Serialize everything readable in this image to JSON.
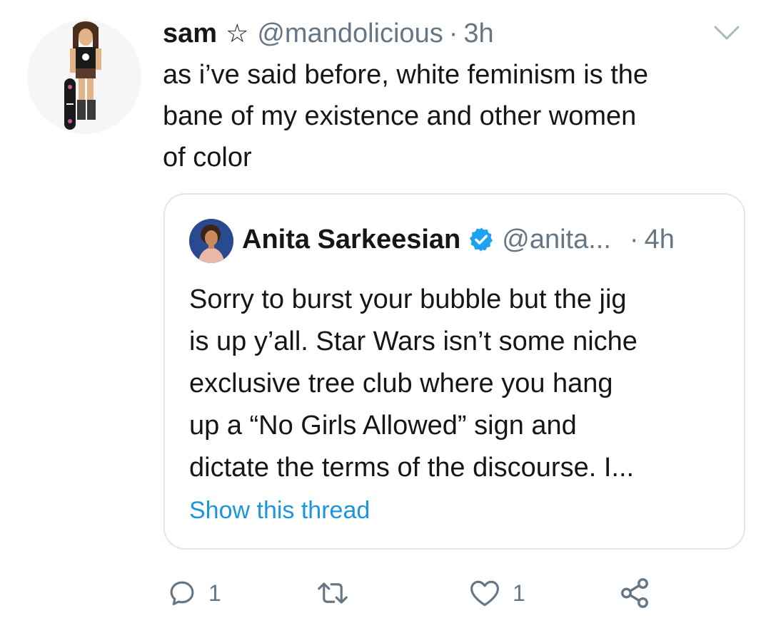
{
  "tweet": {
    "author": {
      "display_name": "sam",
      "badge_icon": "star-outline-icon",
      "handle": "@mandolicious"
    },
    "separator": "·",
    "time": "3h",
    "menu_icon": "chevron-down-icon",
    "lines": [
      "as i’ve said before, white feminism is the",
      "bane of my existence and other women",
      "of color"
    ]
  },
  "quoted_tweet": {
    "author": {
      "display_name": "Anita Sarkeesian",
      "verified_icon": "verified-badge-icon",
      "handle": "@anita..."
    },
    "separator": "·",
    "time": "4h",
    "lines": [
      "Sorry to burst your bubble but the jig",
      "is up y’all. Star Wars isn’t some niche",
      "exclusive tree club where you hang",
      "up a “No Girls Allowed” sign and",
      "dictate the terms of the discourse. I..."
    ],
    "show_thread": "Show this thread"
  },
  "actions": {
    "reply": {
      "icon": "reply-icon",
      "count": "1"
    },
    "retweet": {
      "icon": "retweet-icon",
      "count": ""
    },
    "like": {
      "icon": "heart-icon",
      "count": "1"
    },
    "share": {
      "icon": "share-icon"
    }
  },
  "colors": {
    "text": "#14171a",
    "muted": "#657786",
    "link": "#1b95e0",
    "border": "#e1e8ed",
    "verified": "#1da1f2"
  }
}
